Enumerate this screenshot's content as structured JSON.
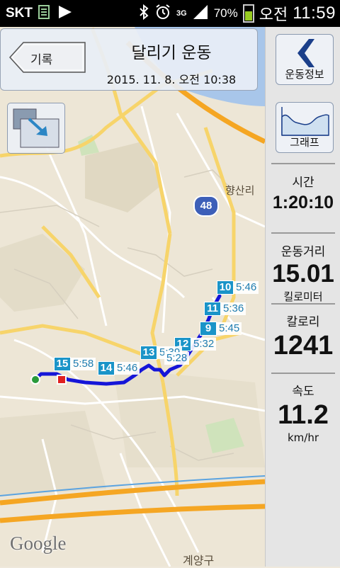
{
  "status_bar": {
    "carrier": "SKT",
    "network": "3G",
    "battery_percent": "70%",
    "ampm": "오전",
    "time": "11:59"
  },
  "header": {
    "back_label": "기록",
    "title": "달리기 운동",
    "datetime": "2015. 11. 8. 오전 10:38"
  },
  "map": {
    "place_label_1": "향산리",
    "place_label_2": "계양구",
    "road_number": "48",
    "attribution": "Google",
    "splits": [
      {
        "km": "10",
        "pace": "5:46"
      },
      {
        "km": "11",
        "pace": "5:36"
      },
      {
        "km": "9",
        "pace": "5:45"
      },
      {
        "km": "12",
        "pace": "5:32"
      },
      {
        "km": "13",
        "pace": "5:39"
      },
      {
        "km": "15",
        "pace": "5:58"
      },
      {
        "km": "14",
        "pace": "5:46"
      },
      {
        "km": "",
        "pace": "5:28"
      }
    ]
  },
  "panel": {
    "info_button_label": "운동정보",
    "graph_button_label": "그래프",
    "time_label": "시간",
    "time_value": "1:20:10",
    "distance_label": "운동거리",
    "distance_value": "15.01",
    "distance_unit": "킬로미터",
    "calorie_label": "칼로리",
    "calorie_value": "1241",
    "speed_label": "속도",
    "speed_value": "11.2",
    "speed_unit": "km/hr"
  },
  "colors": {
    "route": "#1515d8",
    "marker": "#1a94c8",
    "highway": "#f5a623",
    "river": "#a8c6ea"
  }
}
